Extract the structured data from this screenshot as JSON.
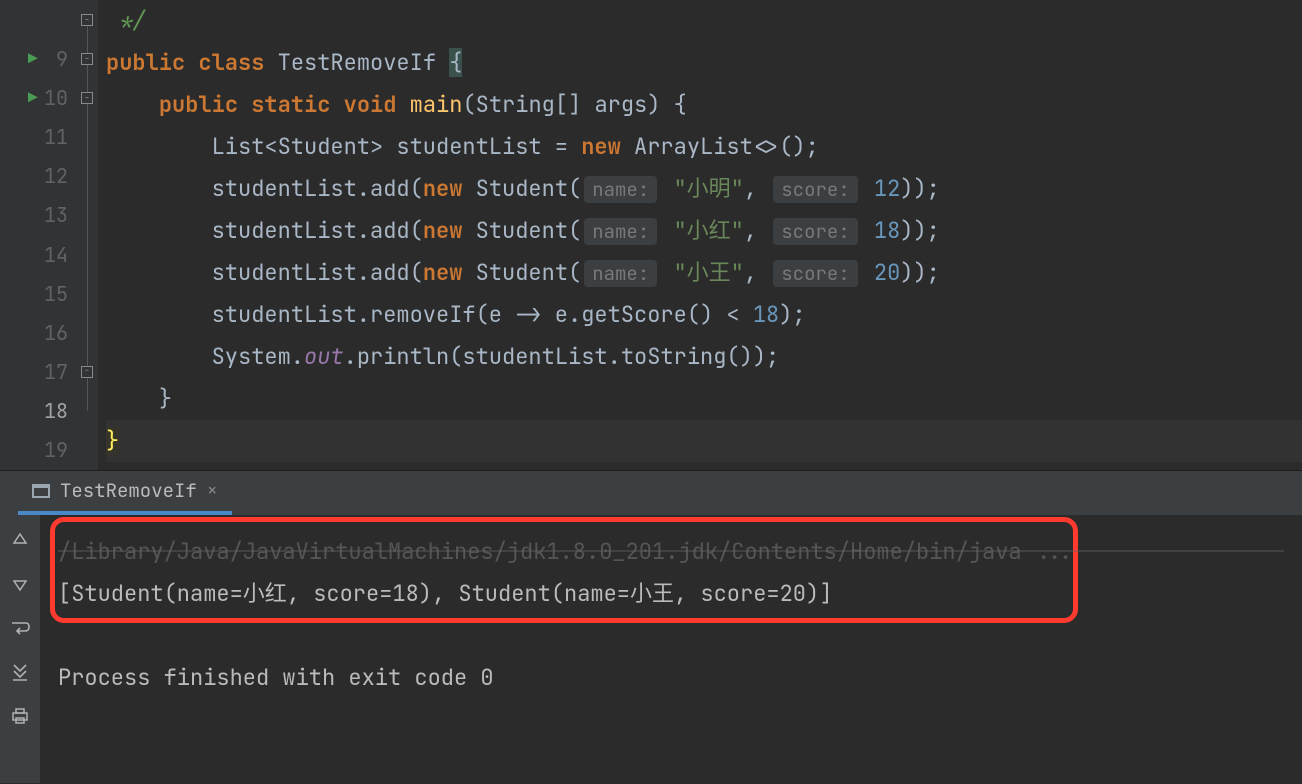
{
  "editor": {
    "lines": {
      "comment_close": "*/",
      "class_kw": "public",
      "class_kw2": "class",
      "class_name": "TestRemoveIf",
      "main_kw1": "public",
      "main_kw2": "static",
      "main_kw3": "void",
      "main_name": "main",
      "main_args": "(String[] args) {",
      "list_type": "List<Student> studentList = ",
      "list_new": "new",
      "list_ctor": " ArrayList<>();",
      "add_prefix": "studentList.add(",
      "student_kw": "new",
      "student_ctor": " Student(",
      "hint_name": "name:",
      "hint_score": "score:",
      "names": [
        "\"小明\"",
        "\"小红\"",
        "\"小王\""
      ],
      "scores": [
        "12",
        "18",
        "20"
      ],
      "add_suffix": "));",
      "removeif": "studentList.removeIf(e -> e.getScore() < ",
      "removeif_num": "18",
      "removeif_end": ");",
      "println_pre": "System.",
      "println_out": "out",
      "println_post": ".println(studentList.toString());",
      "brace_close1": "}",
      "brace_close2": "}"
    },
    "gutter": [
      "",
      "9",
      "10",
      "11",
      "12",
      "13",
      "14",
      "15",
      "16",
      "17",
      "18",
      "19"
    ]
  },
  "tabs": {
    "run_tab": "TestRemoveIf"
  },
  "console": {
    "path_line": "/Library/Java/JavaVirtualMachines/jdk1.8.0_201.jdk/Contents/Home/bin/java ...",
    "output_line": "[Student(name=小红, score=18), Student(name=小王, score=20)]",
    "exit_line": "Process finished with exit code 0"
  }
}
